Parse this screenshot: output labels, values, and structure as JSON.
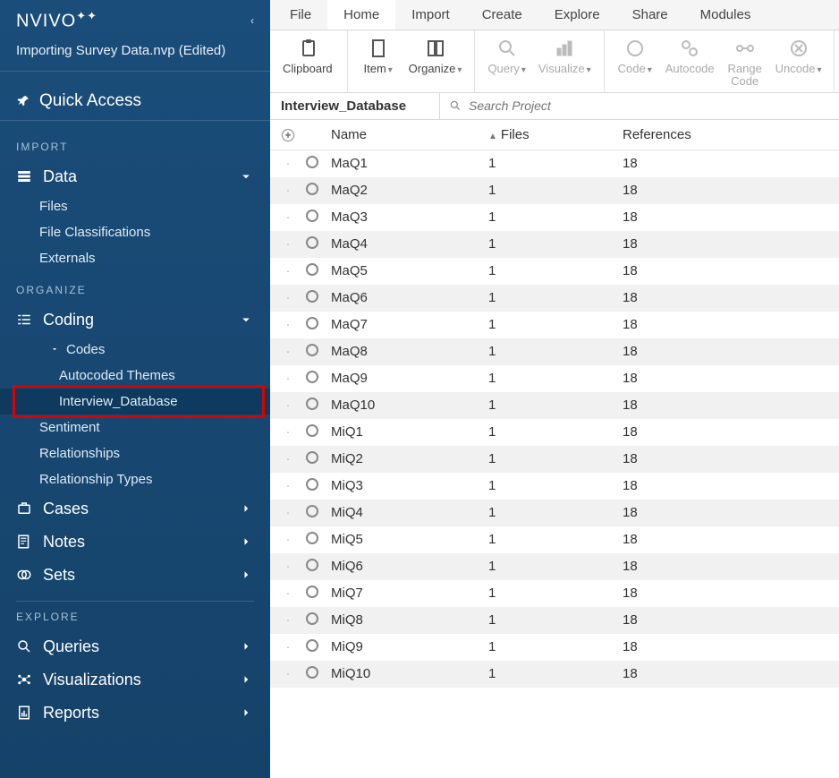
{
  "app": {
    "logo": "NVIVO",
    "project": "Importing Survey Data.nvp (Edited)"
  },
  "sidebar": {
    "quick_access": "Quick Access",
    "sections": {
      "import": "IMPORT",
      "organize": "ORGANIZE",
      "explore": "EXPLORE"
    },
    "data": {
      "label": "Data",
      "items": [
        "Files",
        "File Classifications",
        "Externals"
      ]
    },
    "coding": {
      "label": "Coding",
      "codes_label": "Codes",
      "items": [
        "Autocoded Themes",
        "Interview_Database"
      ],
      "more": [
        "Sentiment",
        "Relationships",
        "Relationship Types"
      ]
    },
    "cases": "Cases",
    "notes": "Notes",
    "sets": "Sets",
    "queries": "Queries",
    "visualizations": "Visualizations",
    "reports": "Reports"
  },
  "menubar": [
    "File",
    "Home",
    "Import",
    "Create",
    "Explore",
    "Share",
    "Modules"
  ],
  "ribbon": {
    "clipboard": "Clipboard",
    "item": "Item",
    "organize": "Organize",
    "query": "Query",
    "visualize": "Visualize",
    "code": "Code",
    "autocode": "Autocode",
    "range_code": "Range Code",
    "uncode": "Uncode"
  },
  "content": {
    "title": "Interview_Database",
    "search_placeholder": "Search Project",
    "columns": {
      "name": "Name",
      "files": "Files",
      "references": "References"
    },
    "rows": [
      {
        "name": "MaQ1",
        "files": "1",
        "refs": "18"
      },
      {
        "name": "MaQ2",
        "files": "1",
        "refs": "18"
      },
      {
        "name": "MaQ3",
        "files": "1",
        "refs": "18"
      },
      {
        "name": "MaQ4",
        "files": "1",
        "refs": "18"
      },
      {
        "name": "MaQ5",
        "files": "1",
        "refs": "18"
      },
      {
        "name": "MaQ6",
        "files": "1",
        "refs": "18"
      },
      {
        "name": "MaQ7",
        "files": "1",
        "refs": "18"
      },
      {
        "name": "MaQ8",
        "files": "1",
        "refs": "18"
      },
      {
        "name": "MaQ9",
        "files": "1",
        "refs": "18"
      },
      {
        "name": "MaQ10",
        "files": "1",
        "refs": "18"
      },
      {
        "name": "MiQ1",
        "files": "1",
        "refs": "18"
      },
      {
        "name": "MiQ2",
        "files": "1",
        "refs": "18"
      },
      {
        "name": "MiQ3",
        "files": "1",
        "refs": "18"
      },
      {
        "name": "MiQ4",
        "files": "1",
        "refs": "18"
      },
      {
        "name": "MiQ5",
        "files": "1",
        "refs": "18"
      },
      {
        "name": "MiQ6",
        "files": "1",
        "refs": "18"
      },
      {
        "name": "MiQ7",
        "files": "1",
        "refs": "18"
      },
      {
        "name": "MiQ8",
        "files": "1",
        "refs": "18"
      },
      {
        "name": "MiQ9",
        "files": "1",
        "refs": "18"
      },
      {
        "name": "MiQ10",
        "files": "1",
        "refs": "18"
      }
    ]
  }
}
